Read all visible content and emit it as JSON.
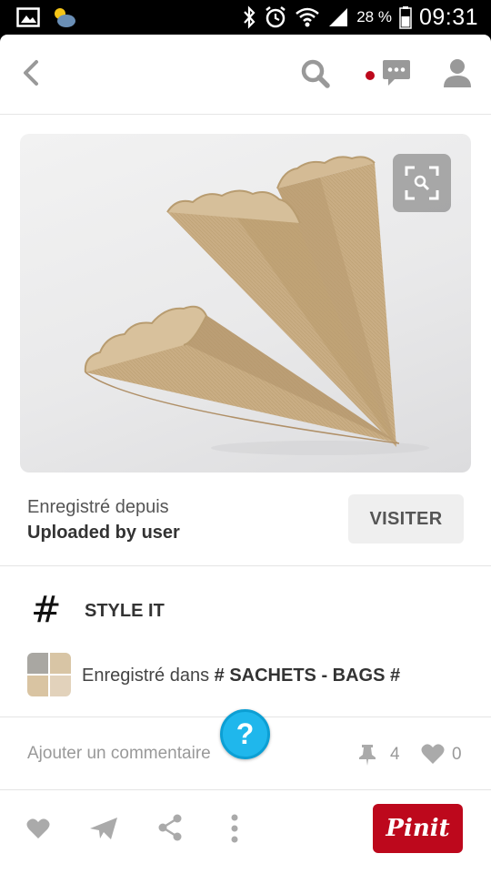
{
  "status_bar": {
    "battery_percent": "28 %",
    "time": "09:31",
    "icons": [
      "gallery-icon",
      "weather-icon",
      "bluetooth-icon",
      "alarm-icon",
      "wifi-icon",
      "signal-icon",
      "battery-icon"
    ]
  },
  "top_bar": {
    "icons": [
      "back-icon",
      "search-icon",
      "notification-dot",
      "messages-icon",
      "profile-icon"
    ],
    "notification_color": "#bd081c"
  },
  "pin": {
    "image_subject": "kraft paper lace cones",
    "zoom_icon": "zoom-search-icon"
  },
  "source": {
    "saved_from_label": "Enregistré depuis",
    "source_name": "Uploaded by user",
    "visit_label": "VISITER"
  },
  "style_it": {
    "icon": "#",
    "label": "STYLE IT"
  },
  "board": {
    "prefix": "Enregistré dans ",
    "name": "# SACHETS - BAGS #"
  },
  "comments": {
    "placeholder": "Ajouter un commentaire",
    "help_label": "?",
    "repin_count": "4",
    "like_count": "0"
  },
  "bottom_bar": {
    "icons": [
      "like-icon",
      "send-icon",
      "share-icon",
      "more-icon"
    ],
    "pinit_label": "Pinit",
    "brand_color": "#bd081c"
  }
}
